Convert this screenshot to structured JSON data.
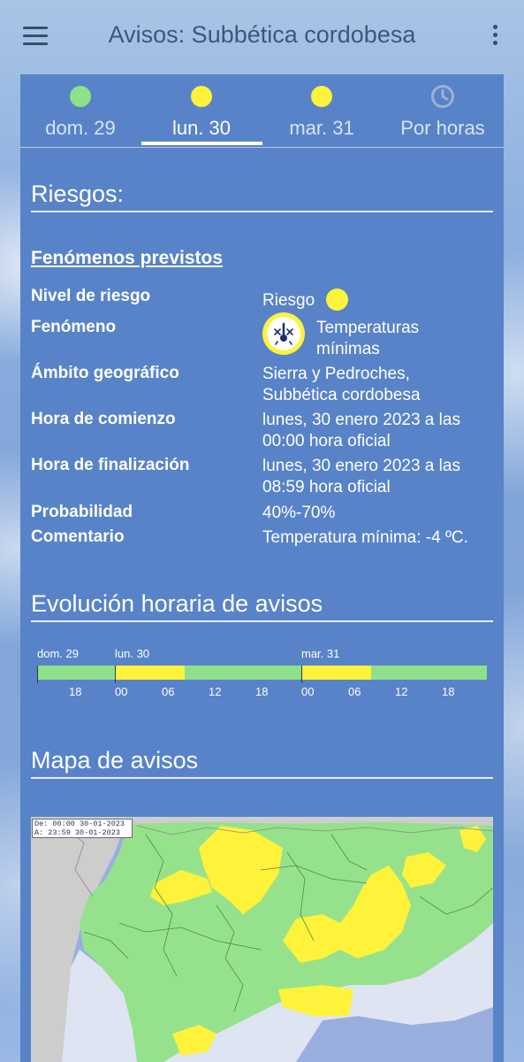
{
  "app_bar": {
    "title": "Avisos: Subbética cordobesa",
    "menu_icon": "hamburger-menu-icon",
    "more_icon": "more-vert-icon"
  },
  "tabs": [
    {
      "label": "dom. 29",
      "level": "green",
      "color": "#8fe08a"
    },
    {
      "label": "lun. 30",
      "level": "yellow",
      "color": "#fff23a",
      "active": true
    },
    {
      "label": "mar. 31",
      "level": "yellow",
      "color": "#fff23a"
    },
    {
      "label": "Por horas",
      "icon": "clock-icon"
    }
  ],
  "riesgos": {
    "heading": "Riesgos:",
    "subheading": "Fenómenos previstos",
    "nivel_label": "Nivel de riesgo",
    "nivel_value": "Riesgo",
    "nivel_color": "#fff23a",
    "fenomeno_label": "Fenómeno",
    "fenomeno_value": "Temperaturas mínimas",
    "fenomeno_icon": "thermometer-snowflake-icon",
    "ambito_label": "Ámbito geográfico",
    "ambito_value": "Sierra y Pedroches, Subbética cordobesa",
    "comienzo_label": "Hora de comienzo",
    "comienzo_value": "lunes, 30 enero 2023 a las 00:00 hora oficial",
    "fin_label": "Hora de finalización",
    "fin_value": "lunes, 30 enero 2023 a las 08:59 hora oficial",
    "probabilidad_label": "Probabilidad",
    "probabilidad_value": "40%-70%",
    "comentario_label": "Comentario",
    "comentario_value": "Temperatura mínima: -4 ºC."
  },
  "evolucion": {
    "heading": "Evolución horaria de avisos",
    "day_labels": [
      "dom. 29",
      "lun. 30",
      "mar. 31"
    ],
    "hour_labels": [
      "18",
      "00",
      "06",
      "12",
      "18",
      "00",
      "06",
      "12",
      "18"
    ],
    "segments": [
      {
        "from": "dom 15:00",
        "to": "lun 00:00",
        "level": "green"
      },
      {
        "from": "lun 00:00",
        "to": "lun 09:00",
        "level": "yellow"
      },
      {
        "from": "lun 09:00",
        "to": "mar 00:00",
        "level": "green"
      },
      {
        "from": "mar 00:00",
        "to": "mar 09:00",
        "level": "yellow"
      },
      {
        "from": "mar 09:00",
        "to": "mar 24:00",
        "level": "green"
      }
    ],
    "colors": {
      "green": "#8fe08a",
      "yellow": "#fff23a"
    }
  },
  "mapa": {
    "heading": "Mapa de avisos",
    "stamp_line1": "De: 00:00 30-01-2023",
    "stamp_line2": "A:  23:59 30-01-2023",
    "colors": {
      "green": "#96e28c",
      "yellow": "#fff23a",
      "land": "#cdcdcd",
      "sea": "#9aaede",
      "coast": "#dfe4f2"
    }
  }
}
